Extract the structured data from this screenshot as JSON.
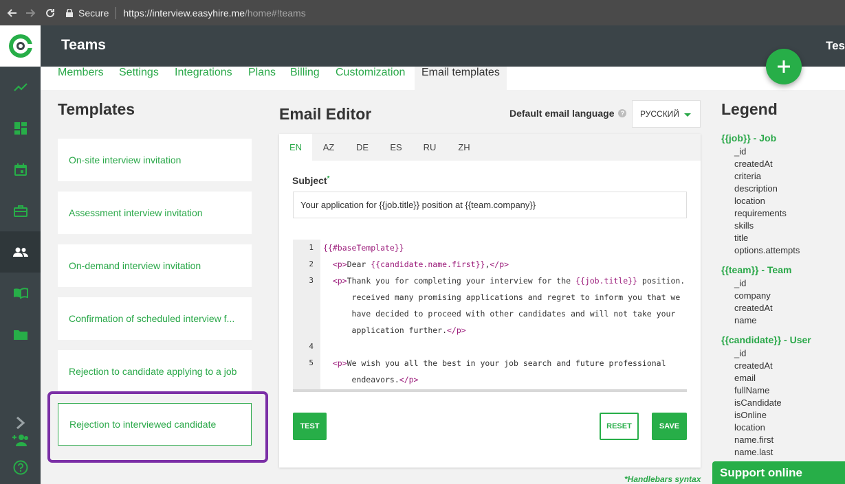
{
  "browser": {
    "secure_label": "Secure",
    "url_main": "https://interview.easyhire.me",
    "url_rest": "/home#!teams"
  },
  "header": {
    "title": "Teams",
    "user": "Tes"
  },
  "tabs": [
    {
      "label": "Members"
    },
    {
      "label": "Settings"
    },
    {
      "label": "Integrations"
    },
    {
      "label": "Plans"
    },
    {
      "label": "Billing"
    },
    {
      "label": "Customization"
    },
    {
      "label": "Email templates",
      "active": true
    }
  ],
  "templates": {
    "title": "Templates",
    "items": [
      {
        "label": "On-site interview invitation"
      },
      {
        "label": "Assessment interview invitation"
      },
      {
        "label": "On-demand interview invitation"
      },
      {
        "label": "Confirmation of scheduled interview f..."
      },
      {
        "label": "Rejection to candidate applying to a job"
      },
      {
        "label": "Rejection to interviewed candidate",
        "selected": true
      }
    ]
  },
  "editor": {
    "title": "Email Editor",
    "default_language_label": "Default email language",
    "help_glyph": "?",
    "language_value": "РУССКИЙ",
    "lang_tabs": [
      "EN",
      "AZ",
      "DE",
      "ES",
      "RU",
      "ZH"
    ],
    "active_lang": "EN",
    "subject_label": "Subject",
    "subject_required_mark": "*",
    "subject_value": "Your application for {{job.title}} position at {{team.company}}",
    "code_lines": [
      {
        "num": "1",
        "text": "{{#baseTemplate}}"
      },
      {
        "num": "2",
        "text": "  <p>Dear {{candidate.name.first}},</p>"
      },
      {
        "num": "3",
        "text": "  <p>Thank you for completing your interview for the {{job.title}} position. We"
      },
      {
        "num": "",
        "text": "      received many promising applications and regret to inform you that we"
      },
      {
        "num": "",
        "text": "      have decided to proceed with other candidates and will not take your"
      },
      {
        "num": "",
        "text": "      application further.</p>"
      },
      {
        "num": "4",
        "text": ""
      },
      {
        "num": "5",
        "text": "  <p>We wish you all the best in your job search and future professional"
      },
      {
        "num": "",
        "text": "      endeavors.</p>"
      }
    ],
    "test_label": "TEST",
    "reset_label": "RESET",
    "save_label": "SAVE",
    "handlebars_note": "*Handlebars syntax"
  },
  "legend": {
    "title": "Legend",
    "groups": [
      {
        "label": "{{job}} - Job",
        "fields": [
          "_id",
          "createdAt",
          "criteria",
          "description",
          "location",
          "requirements",
          "skills",
          "title",
          "options.attempts"
        ]
      },
      {
        "label": "{{team}} - Team",
        "fields": [
          "_id",
          "company",
          "createdAt",
          "name"
        ]
      },
      {
        "label": "{{candidate}} - User",
        "fields": [
          "_id",
          "createdAt",
          "email",
          "fullName",
          "isCandidate",
          "isOnline",
          "location",
          "name.first",
          "name.last"
        ]
      }
    ]
  },
  "support": {
    "label": "Support online"
  },
  "colors": {
    "accent": "#27ae48",
    "nav": "#3b4448",
    "highlight": "#7b2fa6"
  }
}
